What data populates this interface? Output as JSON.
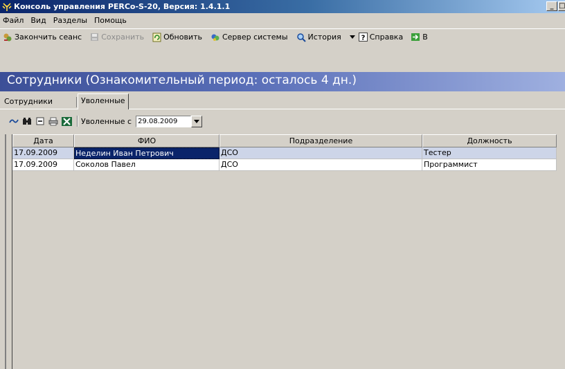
{
  "window": {
    "title": "Консоль управления PERCo-S-20, Версия: 1.4.1.1",
    "min_label": "_",
    "max_label": "□"
  },
  "menu": {
    "items": [
      "Файл",
      "Вид",
      "Разделы",
      "Помощь"
    ]
  },
  "toolbar": {
    "end_session": "Закончить сеанс",
    "save": "Сохранить",
    "refresh": "Обновить",
    "server": "Сервер системы",
    "history": "История",
    "help": "Справка",
    "extra": "В"
  },
  "page": {
    "title": "Сотрудники (Ознакомительный период: осталось 4 дн.)"
  },
  "tabs": [
    "Сотрудники",
    "Уволенные"
  ],
  "filter": {
    "label": "Уволенные с",
    "date": "29.08.2009"
  },
  "table": {
    "columns": [
      "Дата",
      "ФИО",
      "Подразделение",
      "Должность"
    ],
    "rows": [
      {
        "date": "17.09.2009",
        "name": "Неделин Иван Петрович",
        "dept": "ДСО",
        "position": "Тестер"
      },
      {
        "date": "17.09.2009",
        "name": "Соколов Павел",
        "dept": "ДСО",
        "position": "Программист"
      }
    ]
  },
  "colors": {
    "title_band": "#3c4f97",
    "selected_row": "#cdd5e8",
    "focus_cell": "#0a246a"
  }
}
